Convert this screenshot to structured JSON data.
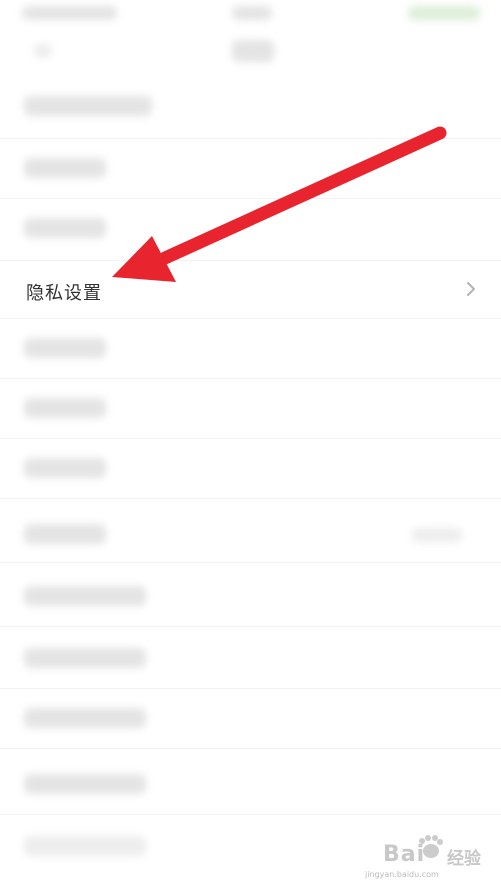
{
  "settings": {
    "privacy_label": "隐私设置",
    "chevron_icon": "chevron-right-icon"
  },
  "annotation": {
    "arrow_color": "#e8242f"
  },
  "watermark": {
    "brand": "Bai",
    "brand_suffix": "经验",
    "url": "jingyan.baidu.com"
  }
}
